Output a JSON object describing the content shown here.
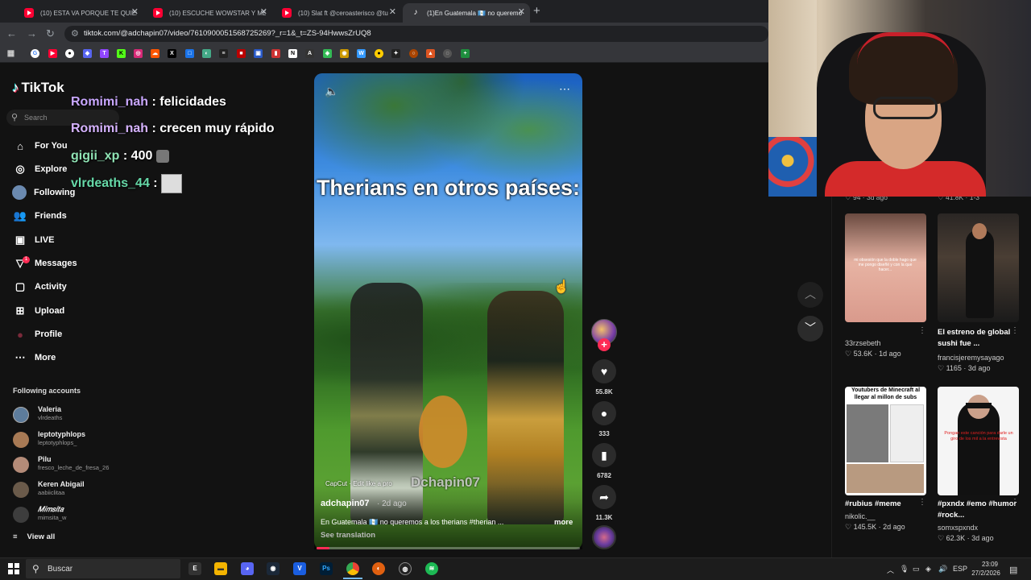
{
  "browser": {
    "tabs": [
      {
        "title": "(10) ESTA VA PORQUE TE QUIER",
        "icon": "youtube-icon"
      },
      {
        "title": "(10) ESCUCHE WOWSTAR Y ME",
        "icon": "youtube-icon"
      },
      {
        "title": "(10) Slat ft @ceroasterisco @tu",
        "icon": "youtube-icon"
      },
      {
        "title": "(1)En Guatemala 🇬🇹 no queremo",
        "icon": "tiktok-icon",
        "active": true
      }
    ],
    "url": "tiktok.com/@adchapin07/video/7610900051568725269?_r=1&_t=ZS-94HwwsZrUQ8"
  },
  "tiktok": {
    "logo": "TikTok",
    "search_placeholder": "Search",
    "nav": [
      {
        "label": "For You",
        "icon": "home-icon"
      },
      {
        "label": "Explore",
        "icon": "compass-icon"
      },
      {
        "label": "Following",
        "icon": "following-avatar-icon"
      },
      {
        "label": "Friends",
        "icon": "friends-icon"
      },
      {
        "label": "LIVE",
        "icon": "live-icon"
      },
      {
        "label": "Messages",
        "icon": "messages-icon"
      },
      {
        "label": "Activity",
        "icon": "activity-icon"
      },
      {
        "label": "Upload",
        "icon": "upload-icon"
      },
      {
        "label": "Profile",
        "icon": "profile-icon"
      },
      {
        "label": "More",
        "icon": "more-icon"
      }
    ],
    "messages_badge": "1",
    "following_title": "Following accounts",
    "following_accounts": [
      {
        "name": "Valeria",
        "handle": "vlrdeaths"
      },
      {
        "name": "leptotyphlops",
        "handle": "leptotyphlops_"
      },
      {
        "name": "Pilu",
        "handle": "fresco_leche_de_fresa_26"
      },
      {
        "name": "Keren Abigail",
        "handle": "aabiiclitaa"
      },
      {
        "name": "𝑀𝑖𝑚𝑠𝑖𝑡𝑎",
        "handle": "mimsita_w"
      }
    ],
    "view_all": "View all",
    "video": {
      "caption": "Therians en otros países:",
      "capcut": "CapCut · Edit like a pro",
      "watermark": "Dchapin07",
      "author": "adchapin07",
      "time": "· 2d ago",
      "description": "En Guatemala 🇬🇹 no queremos a los therians #therian ...",
      "more": "more",
      "see_translation": "See translation",
      "progress": 0.05
    },
    "actions": {
      "likes": "55.8K",
      "comments": "333",
      "saves": "6782",
      "shares": "11.3K"
    },
    "recommended_top": {
      "left": "♡ 94 · 3d ago",
      "right": "♡ 41.8K · 1-3"
    },
    "recommended": [
      {
        "title": "",
        "author": "33rzsebeth",
        "stats": "♡ 53.6K · 1d ago",
        "thumb": "#e2a99a",
        "overlay": "mi obsesión que la doble hago que me pongo diseñé y con la que hacer..."
      },
      {
        "title": "El estreno de global sushi fue ...",
        "author": "francisjeremysayago",
        "stats": "♡ 1165 · 3d ago",
        "thumb": "#3a3a3a",
        "overlay": ""
      },
      {
        "title": "#rubius #meme",
        "author": "nikolic.__",
        "stats": "♡ 145.5K · 2d ago",
        "thumb": "#ffffff",
        "overlay": "Youtubers de Minecraft al llegar al millon de subs"
      },
      {
        "title": "#pxndx #emo #humor #rock...",
        "author": "somxspxndx",
        "stats": "♡ 62.3K · 3d ago",
        "thumb": "#f4f4f4",
        "overlay": "Pongan este canción para darle un giro de los mil a la entrevista"
      }
    ]
  },
  "chat": [
    {
      "user": "Romimi_nah",
      "message": "felicidades"
    },
    {
      "user": "Romimi_nah",
      "message": "crecen muy rápido"
    },
    {
      "user": "gigii_xp",
      "message": "400"
    },
    {
      "user": "vlrdeaths_44",
      "message": ""
    }
  ],
  "taskbar": {
    "search": "Buscar",
    "language": "ESP",
    "time": "23:09",
    "date": "27/2/2026"
  },
  "colors": {
    "tiktok_red": "#fe2c55",
    "tiktok_cyan": "#25f4ee",
    "chrome_dark": "#202124"
  }
}
